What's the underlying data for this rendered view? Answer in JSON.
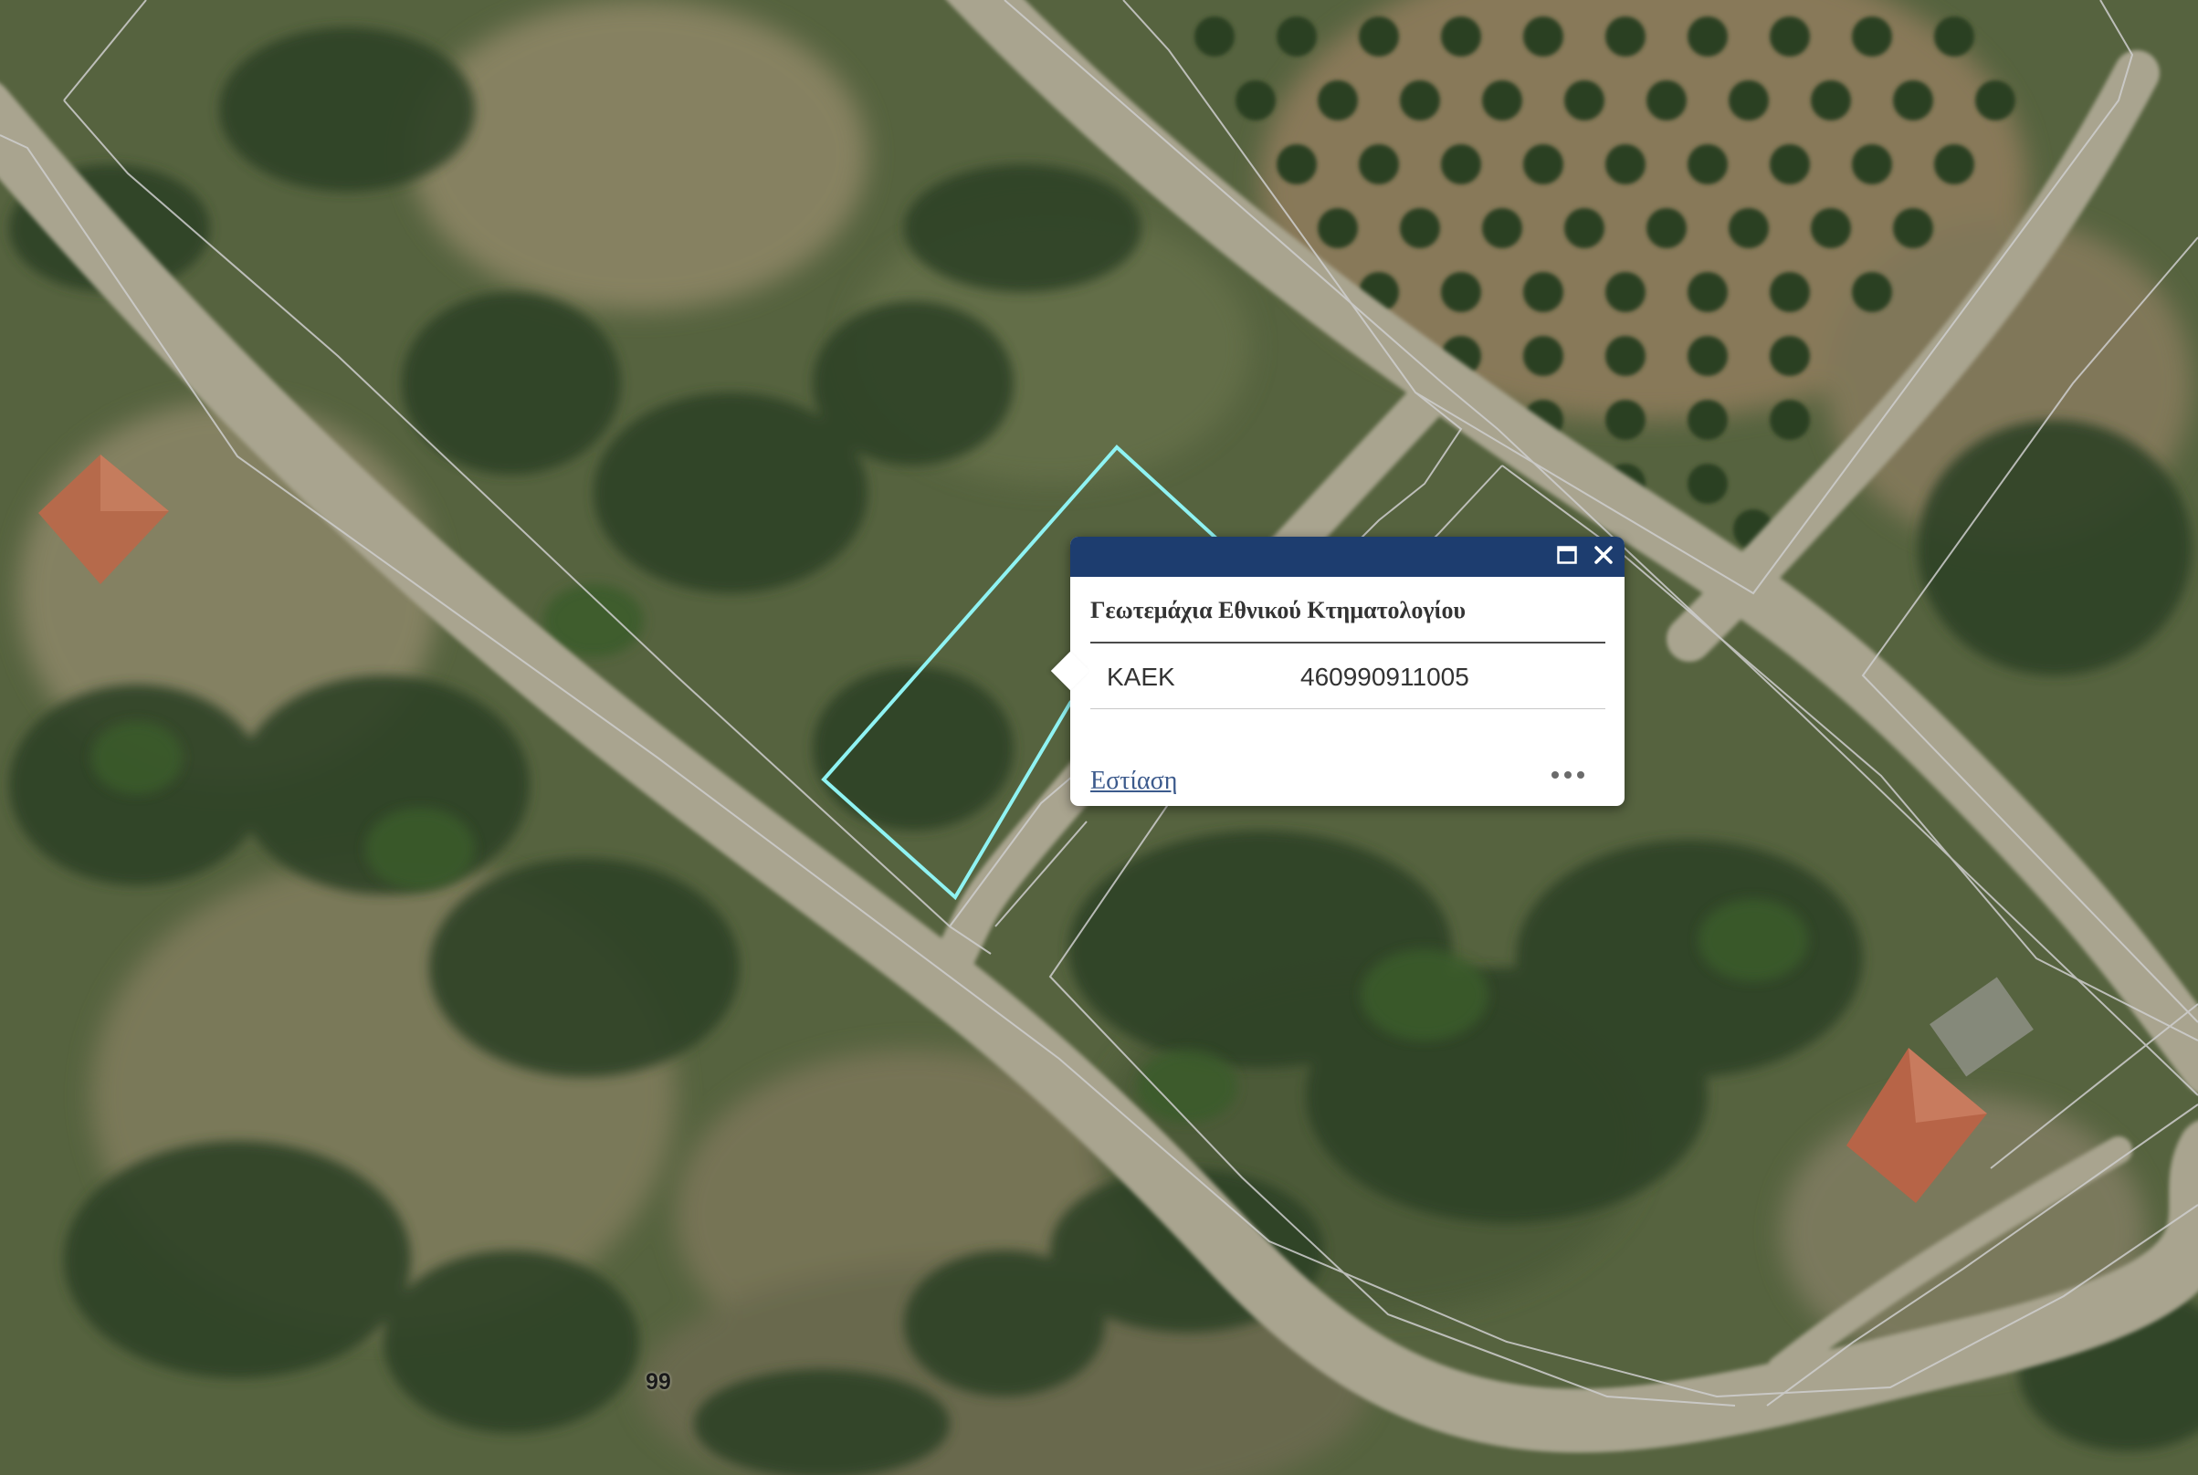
{
  "map": {
    "basemap": "satellite-imagery",
    "parcel_label": "99",
    "highlight_color": "#8ff3f3",
    "boundary_color": "#c9c9c9"
  },
  "popup": {
    "title": "Γεωτεμάχια Εθνικού Κτηματολογίου",
    "header_color": "#1d3d6f",
    "attributes": [
      {
        "key": "ΚΑΕΚ",
        "value": "460990911005"
      }
    ],
    "zoom_label": "Εστίαση",
    "icons": {
      "maximize": "maximize-icon",
      "close": "close-icon",
      "more": "more-options-icon"
    }
  }
}
